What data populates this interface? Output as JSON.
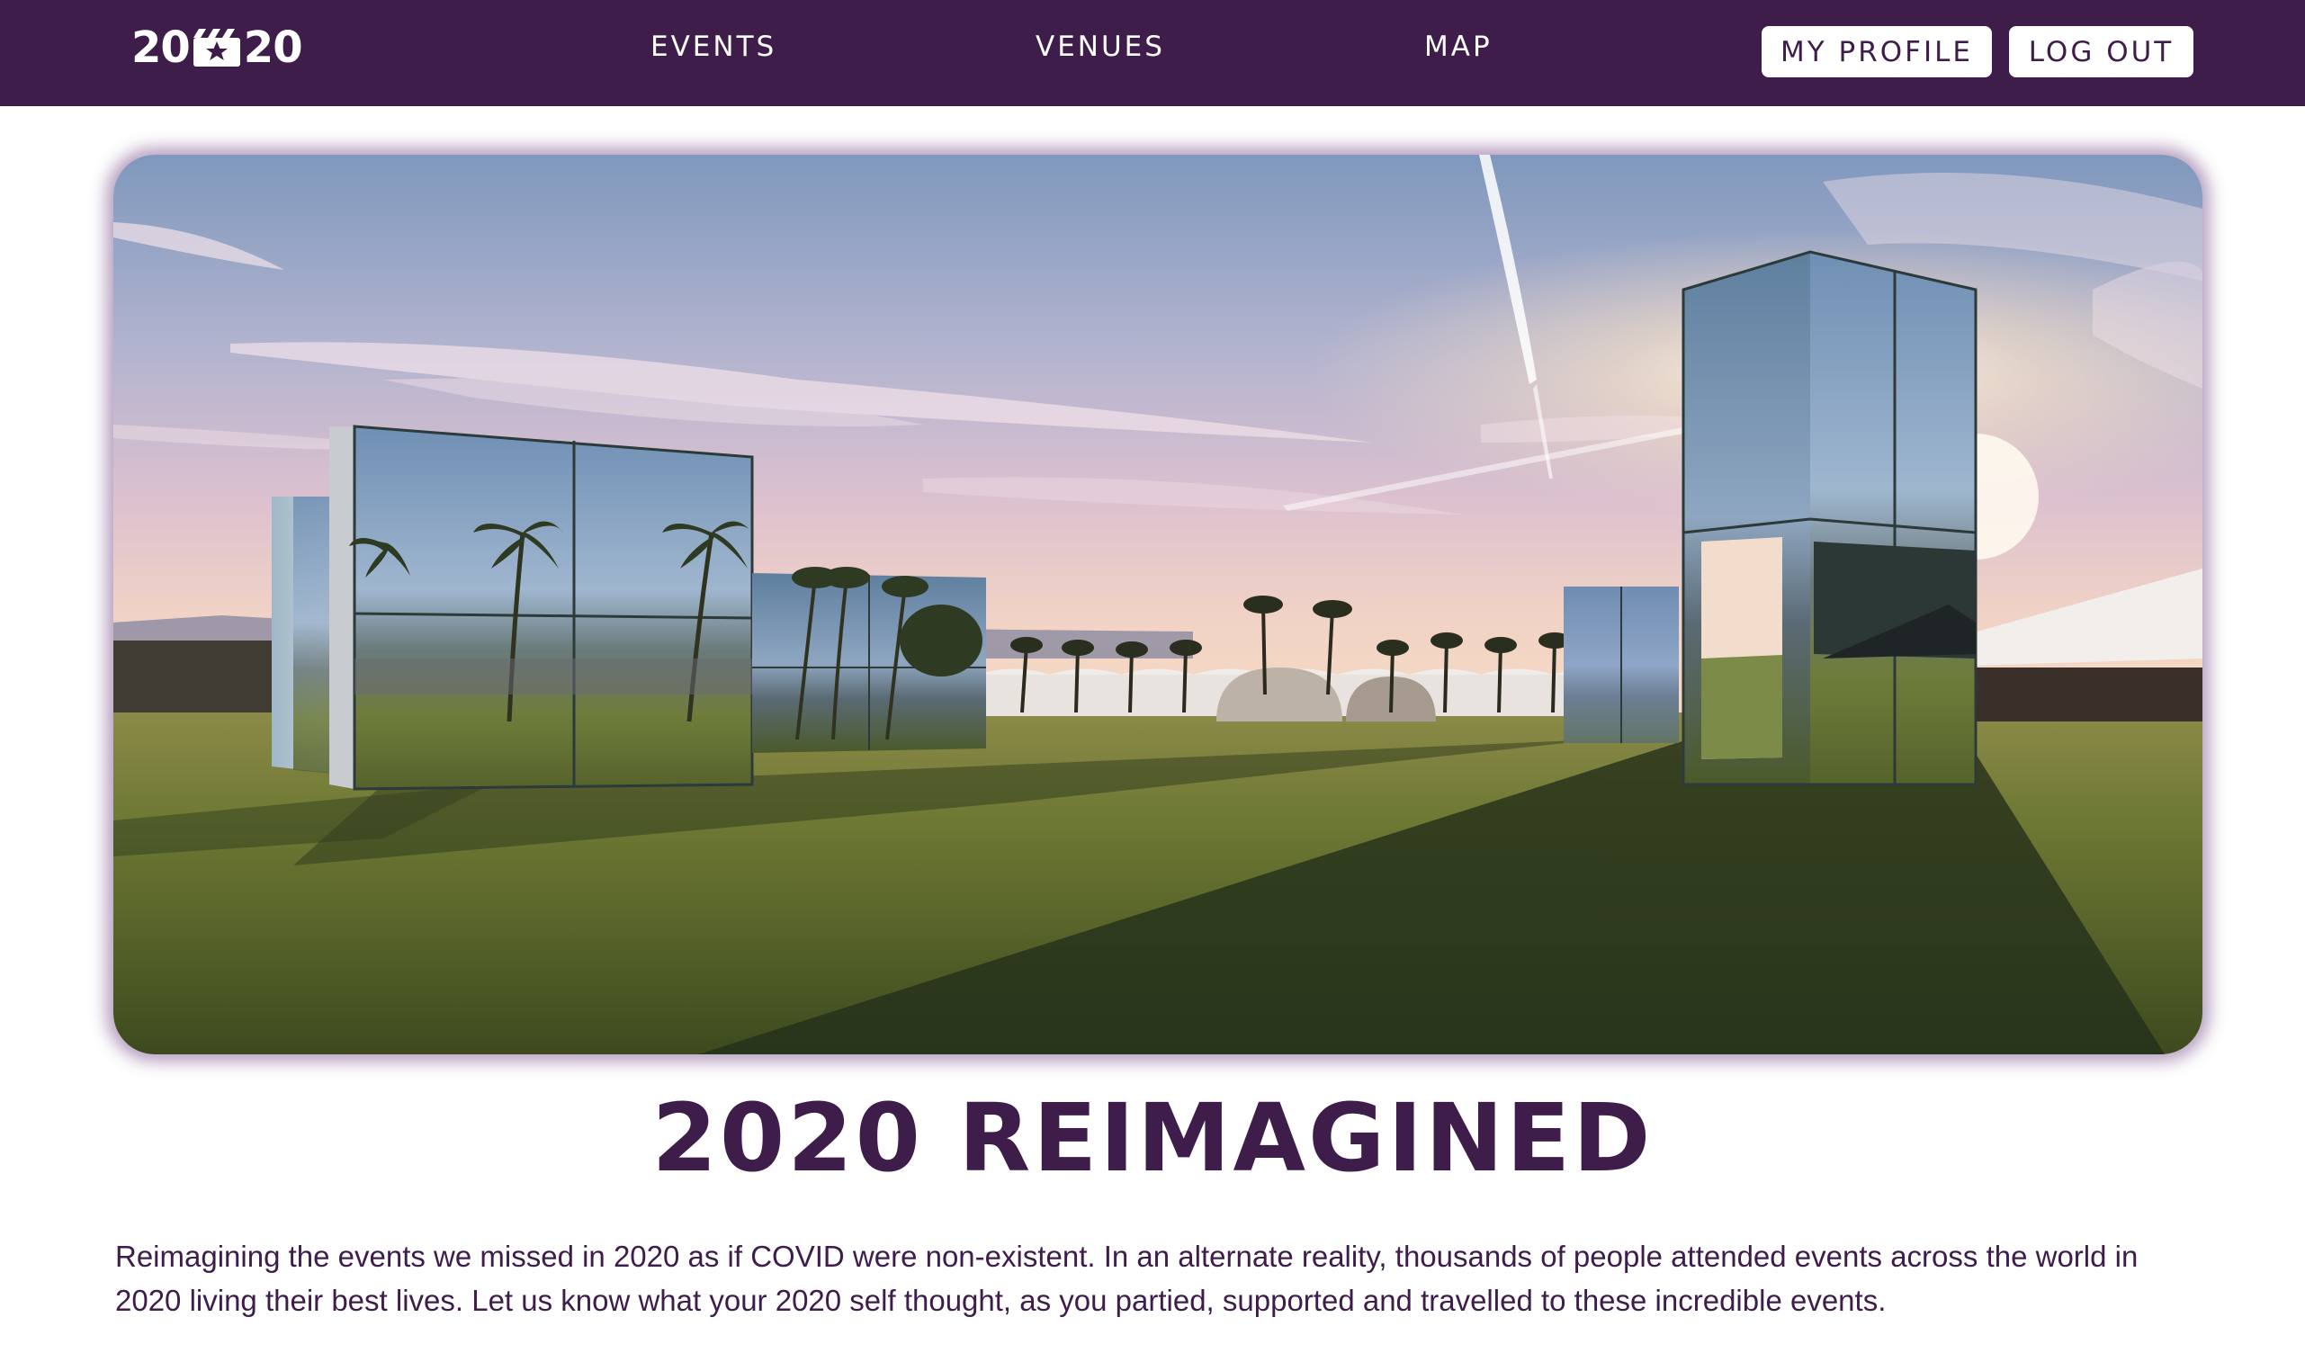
{
  "navbar": {
    "logo_left": "20",
    "logo_right": "20",
    "links": {
      "events": "EVENTS",
      "venues": "VENUES",
      "map": "MAP"
    },
    "buttons": {
      "profile": "MY PROFILE",
      "logout": "LOG OUT"
    }
  },
  "hero": {
    "image_icon": "festival-mirror-installation-photo"
  },
  "main": {
    "title": "2020 REIMAGINED",
    "intro": "Reimagining the events we missed in 2020 as if COVID were non-existent. In an alternate reality, thousands of people attended events across the world in 2020 living their best lives. Let us know what your 2020 self thought, as you partied, supported and travelled to these incredible events."
  },
  "colors": {
    "brand_purple": "#3e1d4b",
    "white": "#ffffff"
  }
}
